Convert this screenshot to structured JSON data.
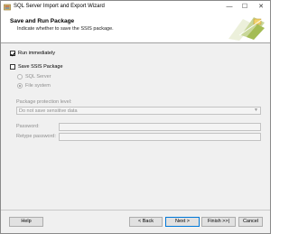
{
  "window": {
    "title": "SQL Server Import and Export Wizard",
    "minimize": "—",
    "maximize": "☐",
    "close": "✕"
  },
  "header": {
    "title": "Save and Run Package",
    "subtitle": "Indicate whether to save the SSIS package.",
    "graphic": "wizard-graphic-icon"
  },
  "options": {
    "run_immediately": {
      "label": "Run immediately",
      "checked": true
    },
    "save_ssis_package": {
      "label": "Save SSIS Package",
      "checked": false
    },
    "sql_server": {
      "label": "SQL Server",
      "selected": false,
      "enabled": false
    },
    "file_system": {
      "label": "File system",
      "selected": true,
      "enabled": false
    }
  },
  "protection": {
    "label": "Package protection level:",
    "value": "Do not save sensitive data"
  },
  "password": {
    "label": "Password:",
    "value": ""
  },
  "retype_password": {
    "label": "Retype password:",
    "value": ""
  },
  "buttons": {
    "help": "Help",
    "back": "< Back",
    "next": "Next >",
    "finish": "Finish >>|",
    "cancel": "Cancel"
  },
  "colors": {
    "accent": "#0078d7",
    "disabled_text": "#8e8e8e",
    "header_background": "#ffffff",
    "body_background": "#f0f0f0"
  }
}
